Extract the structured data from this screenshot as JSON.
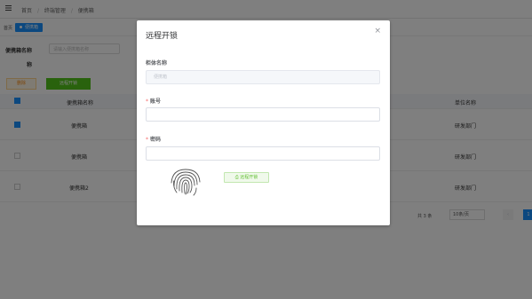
{
  "breadcrumb": [
    "首页",
    "/",
    "终端管理",
    "/",
    "便携箱"
  ],
  "tags": {
    "home": "首页",
    "active": "便携箱"
  },
  "filter": {
    "label": "便携箱名称",
    "placeholder": "请输入便携箱名称",
    "label2": "称"
  },
  "toolbar": {
    "delete_label": "删除",
    "remote_label": "远程开锁"
  },
  "table": {
    "columns": [
      "便携箱名称",
      "单位名称"
    ],
    "rows": [
      {
        "name": "便携箱",
        "dept": "研发部门",
        "checked": true
      },
      {
        "name": "便携箱",
        "dept": "研发部门",
        "checked": false
      },
      {
        "name": "便携箱2",
        "dept": "研发部门",
        "checked": false
      }
    ]
  },
  "pagination": {
    "total": "共 3 条",
    "page_size": "10条/页",
    "current": "1"
  },
  "dialog": {
    "title": "远程开锁",
    "close": "×",
    "fields": {
      "cabinet_label": "柜体名称",
      "cabinet_value": "便携箱",
      "account_label": "账号",
      "account_value": "",
      "password_label": "密码",
      "password_value": ""
    },
    "required_mark": "*",
    "open_button": "远程开锁",
    "fingerprint_icon": "fingerprint-icon"
  }
}
